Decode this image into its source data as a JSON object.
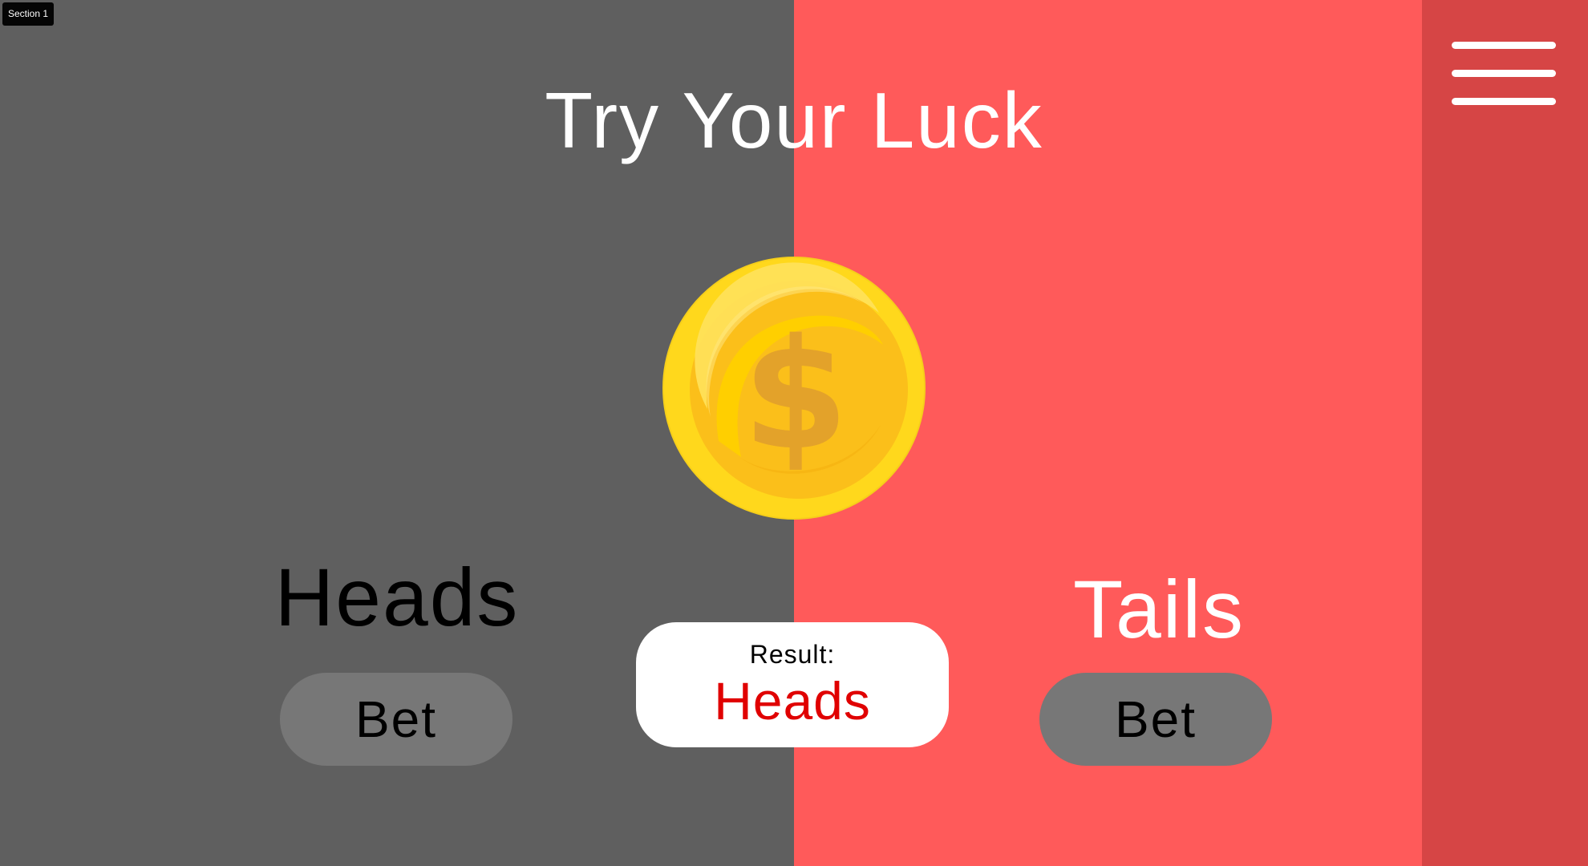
{
  "section": {
    "tag": "Section 1"
  },
  "header": {
    "title": "Try Your Luck"
  },
  "coin": {
    "icon": "dollar-coin-icon",
    "symbol": "$"
  },
  "heads": {
    "label": "Heads",
    "bet_label": "Bet"
  },
  "tails": {
    "label": "Tails",
    "bet_label": "Bet"
  },
  "result": {
    "label": "Result:",
    "value": "Heads"
  },
  "colors": {
    "left_panel": "#5f5f5f",
    "right_panel": "#ff5a5a",
    "menu_panel": "#d64545",
    "result_text": "#e00000",
    "coin_gold": "#ffd000"
  }
}
